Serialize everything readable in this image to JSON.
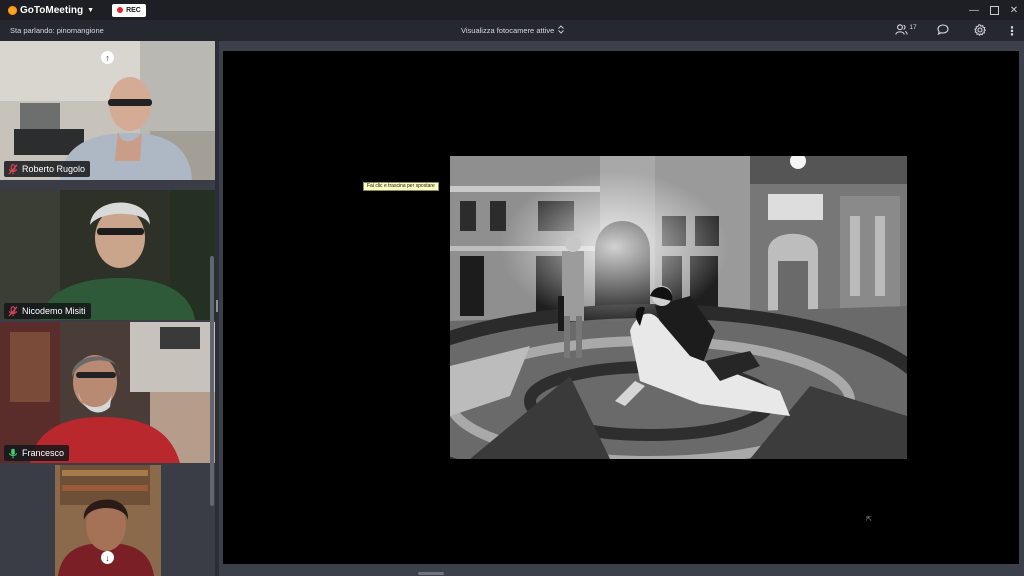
{
  "titlebar": {
    "app_name": "GoToMeeting",
    "rec_label": "REC",
    "icons": [
      "minimize-icon",
      "maximize-icon",
      "close-icon"
    ]
  },
  "toolbar": {
    "speaking_text": "Sta parlando: pinomangione",
    "cameras_label": "Visualizza fotocamere attive",
    "attendee_count": "17",
    "icons": [
      "people-icon",
      "chat-icon",
      "gear-icon",
      "more-icon"
    ]
  },
  "sidebar": {
    "participants": [
      {
        "name": "Roberto Rugolo",
        "mic": "muted"
      },
      {
        "name": "Nicodemo Misiti",
        "mic": "muted"
      },
      {
        "name": "Francesco",
        "mic": "active"
      },
      {
        "name": "",
        "mic": "none"
      }
    ]
  },
  "stage": {
    "tooltip": "Fai clic e trascina per spostare"
  },
  "colors": {
    "titlebar": "#1d1f25",
    "toolbar": "#25282f",
    "stage": "#000000",
    "rec_dot": "#e3262b",
    "muted_mic": "#e0465a",
    "active_mic": "#3fcf6e",
    "logo": "#f5a623"
  }
}
